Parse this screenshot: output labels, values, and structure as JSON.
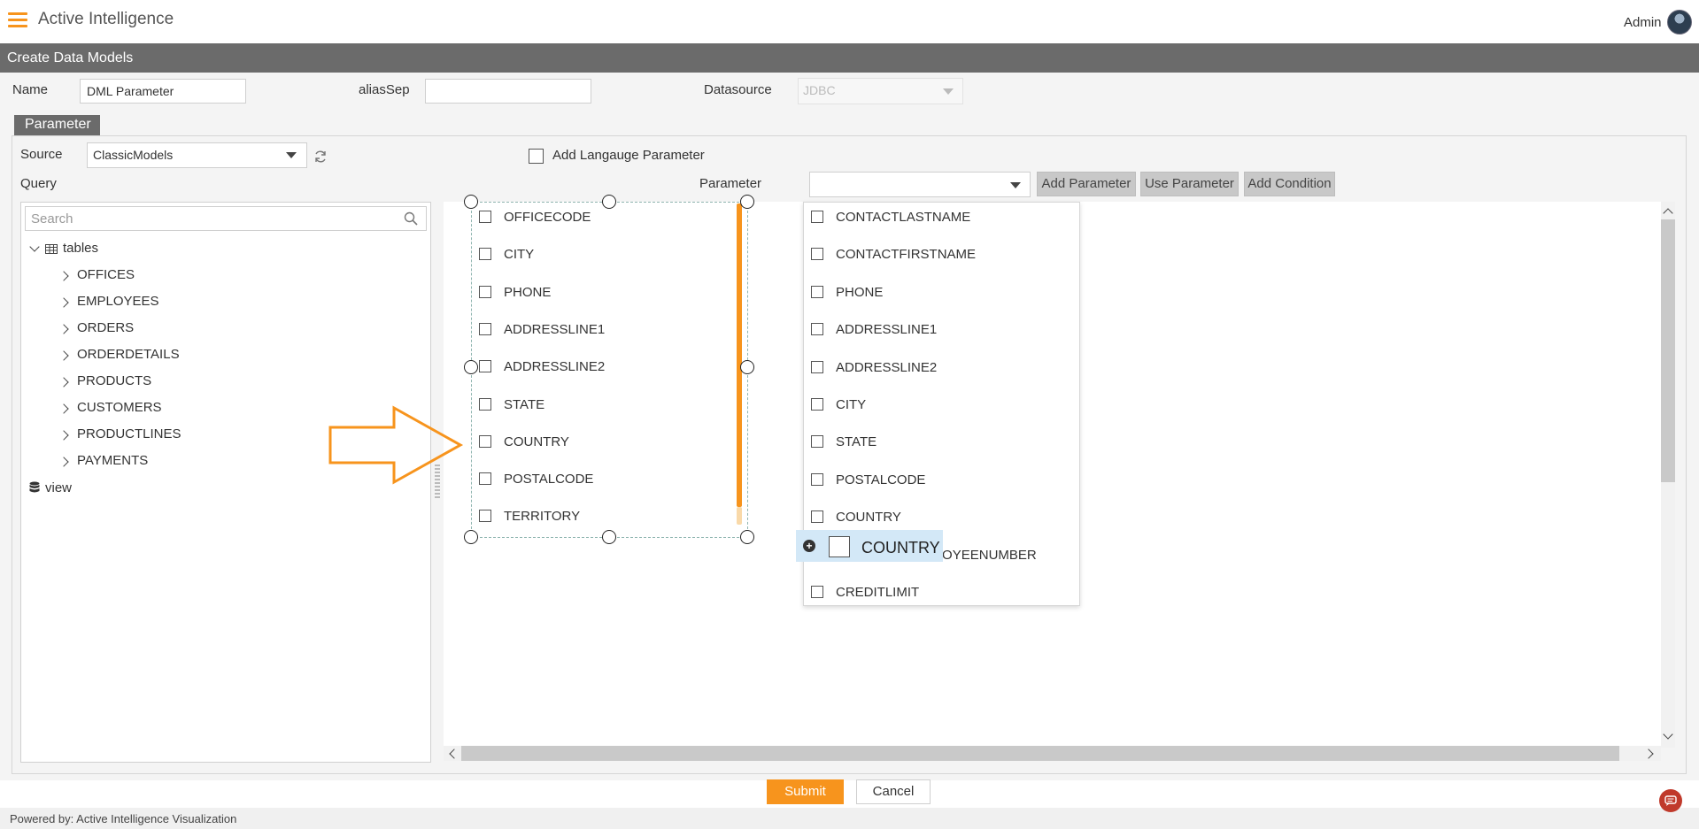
{
  "app": {
    "title": "Active Intelligence",
    "user": "Admin",
    "page_title": "Create Data Models"
  },
  "form": {
    "name_label": "Name",
    "name_value": "DML Parameter",
    "alias_label": "aliasSep",
    "alias_value": "",
    "datasource_label": "Datasource",
    "datasource_value": "JDBC"
  },
  "tabs": [
    {
      "label": "Parameter"
    }
  ],
  "parameter": {
    "source_label": "Source",
    "source_value": "ClassicModels",
    "add_language_label": "Add Langauge Parameter",
    "query_label": "Query",
    "parameter_label": "Parameter",
    "parameter_value": "",
    "buttons": {
      "add_parameter": "Add Parameter",
      "use_parameter": "Use Parameter",
      "add_condition": "Add Condition"
    }
  },
  "tree": {
    "search_placeholder": "Search",
    "root": "tables",
    "tables": [
      "OFFICES",
      "EMPLOYEES",
      "ORDERS",
      "ORDERDETAILS",
      "PRODUCTS",
      "CUSTOMERS",
      "PRODUCTLINES",
      "PAYMENTS"
    ],
    "view": "view"
  },
  "offices_fields": [
    "OFFICECODE",
    "CITY",
    "PHONE",
    "ADDRESSLINE1",
    "ADDRESSLINE2",
    "STATE",
    "COUNTRY",
    "POSTALCODE",
    "TERRITORY"
  ],
  "customer_fields": [
    "CONTACTLASTNAME",
    "CONTACTFIRSTNAME",
    "PHONE",
    "ADDRESSLINE1",
    "ADDRESSLINE2",
    "CITY",
    "STATE",
    "POSTALCODE",
    "COUNTRY",
    "SALESREPEMPLOYEENUMBER",
    "CREDITLIMIT"
  ],
  "drag_chip": {
    "label": "COUNTRY"
  },
  "footer": {
    "submit": "Submit",
    "cancel": "Cancel",
    "powered_by": "Powered by: Active Intelligence Visualization"
  },
  "colors": {
    "accent": "#f7941d",
    "header_gray": "#6b6b6b",
    "chip_blue": "#d3e8f7"
  }
}
